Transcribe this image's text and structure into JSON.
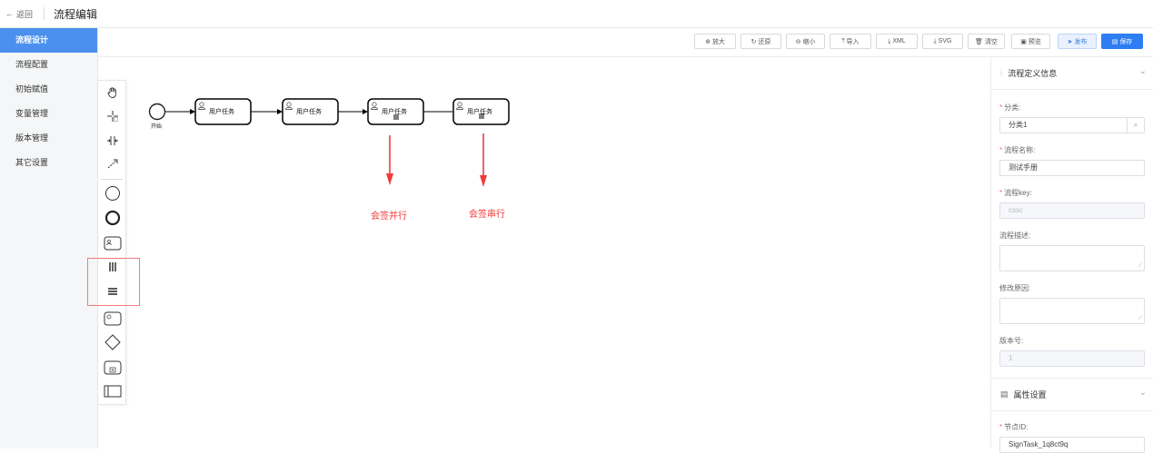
{
  "header": {
    "back_label": "返回",
    "title": "流程编辑"
  },
  "sidebar": {
    "items": [
      {
        "label": "流程设计",
        "active": true
      },
      {
        "label": "流程配置"
      },
      {
        "label": "初始赋值"
      },
      {
        "label": "变量管理"
      },
      {
        "label": "版本管理"
      },
      {
        "label": "其它设置"
      }
    ]
  },
  "toolbar": {
    "zoom_in": "放大",
    "reset": "还原",
    "zoom_out": "缩小",
    "import": "导入",
    "xml": "XML",
    "svg": "SVG",
    "clear": "清空",
    "preview": "预览",
    "publish": "发布",
    "save": "保存"
  },
  "diagram": {
    "start_label": "开始",
    "tasks": [
      "用户任务",
      "用户任务",
      "用户任务",
      "用户任务"
    ],
    "annotations": [
      "会签并行",
      "会签串行"
    ],
    "accent": "#f03a3a"
  },
  "right_panel": {
    "section1_title": "流程定义信息",
    "category_label": "分类:",
    "category_value": "分类1",
    "name_label": "流程名称:",
    "name_value": "测试手册",
    "key_label": "流程key:",
    "key_value": "cssc",
    "desc_label": "流程描述:",
    "reason_label": "修改原因:",
    "version_label": "版本号:",
    "version_value": "1",
    "section2_title": "属性设置",
    "node_id_label": "节点ID:",
    "node_id_value": "SignTask_1q8ct9q"
  },
  "colors": {
    "primary": "#2f7df3",
    "sidebar_active": "#4b90ee",
    "annotation": "#f03a3a"
  }
}
